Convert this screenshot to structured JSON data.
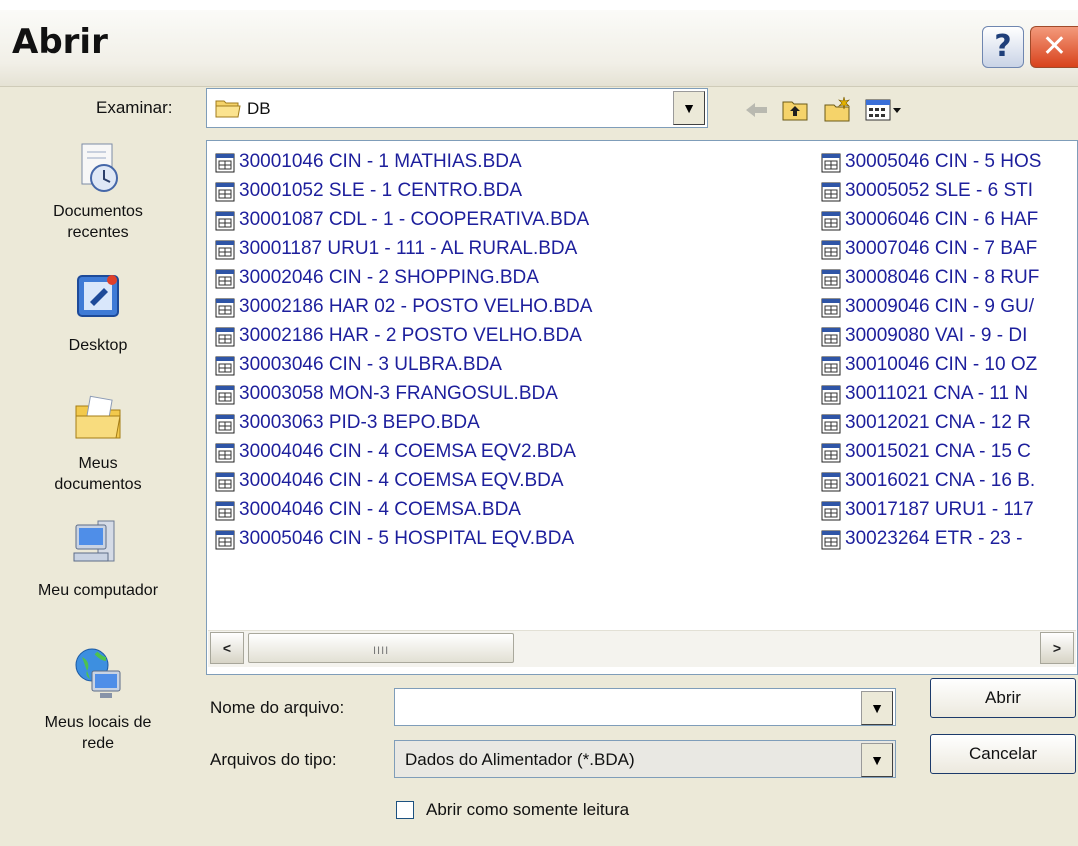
{
  "dialog": {
    "title": "Abrir",
    "help_label": "?",
    "close_label": "✕"
  },
  "lookin": {
    "label": "Examinar:",
    "value": "DB"
  },
  "places": [
    {
      "label_line1": "Documentos",
      "label_line2": "recentes",
      "icon": "recent-documents-icon"
    },
    {
      "label_line1": "Desktop",
      "label_line2": "",
      "icon": "desktop-icon"
    },
    {
      "label_line1": "Meus",
      "label_line2": "documentos",
      "icon": "my-documents-icon"
    },
    {
      "label_line1": "Meu computador",
      "label_line2": "",
      "icon": "my-computer-icon"
    },
    {
      "label_line1": "Meus locais de",
      "label_line2": "rede",
      "icon": "network-places-icon"
    }
  ],
  "files_col1": [
    "30001046 CIN - 1 MATHIAS.BDA",
    "30001052 SLE - 1 CENTRO.BDA",
    "30001087 CDL - 1 - COOPERATIVA.BDA",
    "30001187 URU1 - 111 - AL RURAL.BDA",
    "30002046 CIN - 2 SHOPPING.BDA",
    "30002186 HAR  02 - POSTO VELHO.BDA",
    "30002186 HAR  - 2 POSTO VELHO.BDA",
    "30003046 CIN - 3 ULBRA.BDA",
    "30003058 MON-3 FRANGOSUL.BDA",
    "30003063 PID-3 BEPO.BDA",
    "30004046 CIN - 4 COEMSA EQV2.BDA",
    "30004046 CIN - 4 COEMSA EQV.BDA",
    "30004046 CIN - 4 COEMSA.BDA",
    "30005046 CIN - 5 HOSPITAL EQV.BDA"
  ],
  "files_col2": [
    "30005046 CIN - 5 HOS",
    "30005052 SLE - 6 STI",
    "30006046 CIN - 6 HAF",
    "30007046 CIN - 7 BAF",
    "30008046 CIN - 8 RUF",
    "30009046 CIN - 9 GU/",
    "30009080 VAI - 9 - DI",
    "30010046 CIN - 10 OZ",
    "30011021 CNA - 11 N",
    "30012021 CNA - 12 R",
    "30015021 CNA - 15 C",
    "30016021 CNA - 16 B.",
    "30017187 URU1 - 117",
    "30023264 ETR - 23 -"
  ],
  "scrollbar": {
    "left_arrow": "<",
    "right_arrow": ">",
    "grip": "IIII"
  },
  "filename": {
    "label": "Nome do arquivo:",
    "value": ""
  },
  "filetype": {
    "label": "Arquivos do tipo:",
    "value": "Dados do Alimentador (*.BDA)"
  },
  "readonly": {
    "label": "Abrir como somente leitura",
    "checked": false
  },
  "buttons": {
    "open": "Abrir",
    "cancel": "Cancelar"
  },
  "colors": {
    "dialog_bg": "#ece9d8",
    "file_text": "#1d1f9c",
    "field_border": "#7f9db9"
  }
}
